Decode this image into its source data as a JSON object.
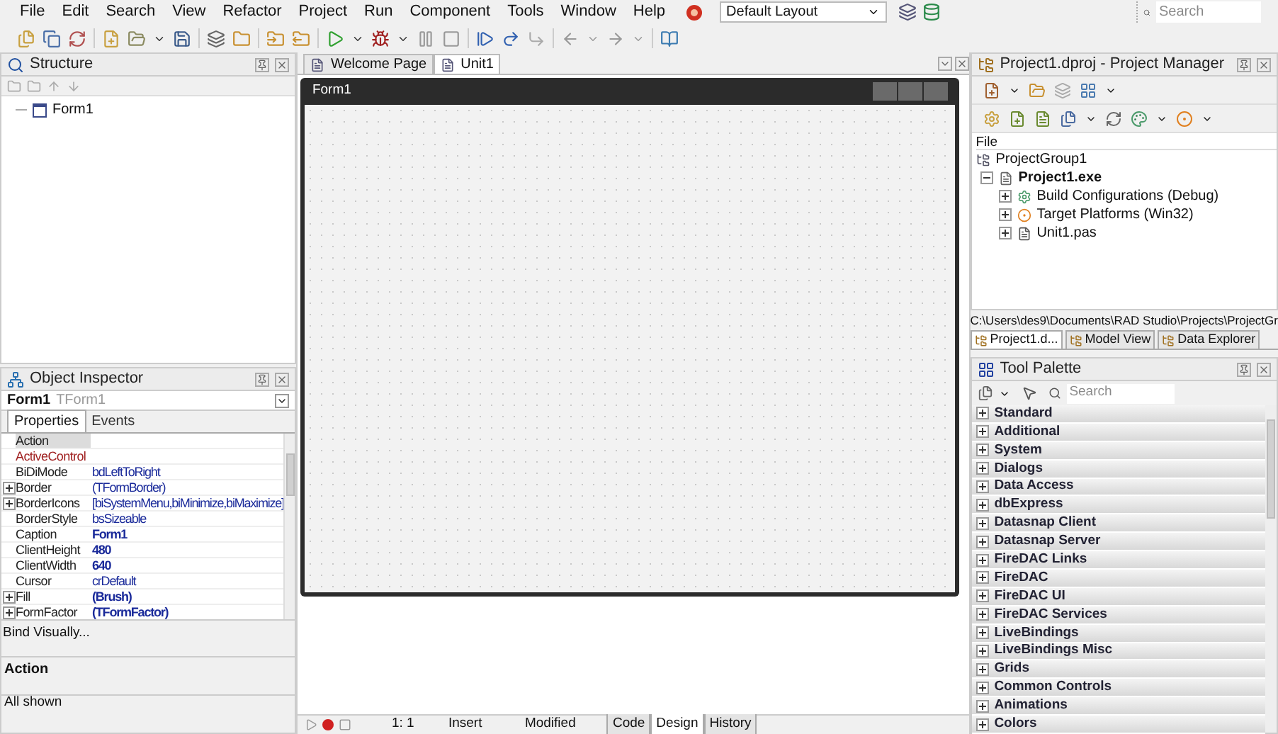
{
  "menu": [
    "File",
    "Edit",
    "Search",
    "View",
    "Refactor",
    "Project",
    "Run",
    "Component",
    "Tools",
    "Window",
    "Help"
  ],
  "layout_combo": {
    "value": "Default Layout"
  },
  "search": {
    "placeholder": "Search"
  },
  "structure": {
    "title": "Structure",
    "tree": [
      {
        "label": "Form1"
      }
    ]
  },
  "object_inspector": {
    "title": "Object Inspector",
    "selector": {
      "name": "Form1",
      "type": "TForm1"
    },
    "tabs": [
      {
        "label": "Properties",
        "selected": true
      },
      {
        "label": "Events",
        "selected": false
      }
    ],
    "properties": [
      {
        "name": "Action",
        "kind": "plain",
        "expandable": false,
        "selected": true
      },
      {
        "name": "ActiveControl",
        "kind": "reference",
        "expandable": false,
        "selected": false
      },
      {
        "name": "BiDiMode",
        "value": "bdLeftToRight",
        "kind": "plain",
        "expandable": false,
        "modified": false,
        "selected": false
      },
      {
        "name": "Border",
        "value": "(TFormBorder)",
        "kind": "plain",
        "expandable": true,
        "modified": false,
        "selected": false
      },
      {
        "name": "BorderIcons",
        "value": "[biSystemMenu,biMinimize,biMaximize]",
        "kind": "plain",
        "expandable": true,
        "modified": false,
        "selected": false
      },
      {
        "name": "BorderStyle",
        "value": "bsSizeable",
        "kind": "plain",
        "expandable": false,
        "modified": false,
        "selected": false
      },
      {
        "name": "Caption",
        "value": "Form1",
        "kind": "plain",
        "expandable": false,
        "modified": true,
        "selected": false
      },
      {
        "name": "ClientHeight",
        "value": "480",
        "kind": "plain",
        "expandable": false,
        "modified": true,
        "selected": false
      },
      {
        "name": "ClientWidth",
        "value": "640",
        "kind": "plain",
        "expandable": false,
        "modified": true,
        "selected": false
      },
      {
        "name": "Cursor",
        "value": "crDefault",
        "kind": "plain",
        "expandable": false,
        "modified": false,
        "selected": false
      },
      {
        "name": "Fill",
        "value": "(Brush)",
        "kind": "plain",
        "expandable": true,
        "modified": true,
        "selected": false
      },
      {
        "name": "FormFactor",
        "value": "(TFormFactor)",
        "kind": "plain",
        "expandable": true,
        "modified": true,
        "selected": false
      }
    ],
    "bind_link": "Bind Visually...",
    "description_title": "Action",
    "status": "All shown"
  },
  "editor": {
    "tabs": [
      {
        "label": "Welcome Page",
        "selected": false
      },
      {
        "label": "Unit1",
        "selected": true
      }
    ],
    "form_title": "Form1",
    "position": "1: 1",
    "mode": "Insert",
    "state": "Modified",
    "view_tabs": [
      {
        "label": "Code",
        "selected": false
      },
      {
        "label": "Design",
        "selected": true
      },
      {
        "label": "History",
        "selected": false
      }
    ]
  },
  "project_manager": {
    "title": "Project1.dproj - Project Manager",
    "column": "File",
    "tree": {
      "label": "ProjectGroup1",
      "children": [
        {
          "label": "Project1.exe",
          "expanded": true,
          "children": [
            {
              "label": "Build Configurations (Debug)",
              "expanded": false,
              "kind": "config"
            },
            {
              "label": "Target Platforms (Win32)",
              "expanded": false,
              "kind": "platform"
            },
            {
              "label": "Unit1.pas",
              "expanded": false,
              "kind": "file"
            }
          ]
        }
      ]
    },
    "path": "C:\\Users\\des9\\Documents\\RAD Studio\\Projects\\ProjectGr",
    "tabs": [
      {
        "label": "Project1.d...",
        "selected": true
      },
      {
        "label": "Model View",
        "selected": false
      },
      {
        "label": "Data Explorer",
        "selected": false
      }
    ]
  },
  "tool_palette": {
    "title": "Tool Palette",
    "search_placeholder": "Search",
    "categories": [
      {
        "label": "Standard",
        "expanded": false
      },
      {
        "label": "Additional",
        "expanded": false
      },
      {
        "label": "System",
        "expanded": false
      },
      {
        "label": "Dialogs",
        "expanded": false
      },
      {
        "label": "Data Access",
        "expanded": false
      },
      {
        "label": "dbExpress",
        "expanded": false
      },
      {
        "label": "Datasnap Client",
        "expanded": false
      },
      {
        "label": "Datasnap Server",
        "expanded": false
      },
      {
        "label": "FireDAC Links",
        "expanded": false
      },
      {
        "label": "FireDAC",
        "expanded": false
      },
      {
        "label": "FireDAC UI",
        "expanded": false
      },
      {
        "label": "FireDAC Services",
        "expanded": false
      },
      {
        "label": "LiveBindings",
        "expanded": false
      },
      {
        "label": "LiveBindings Misc",
        "expanded": false
      },
      {
        "label": "Grids",
        "expanded": false
      },
      {
        "label": "Common Controls",
        "expanded": false
      },
      {
        "label": "Animations",
        "expanded": false
      },
      {
        "label": "Colors",
        "expanded": false
      }
    ]
  }
}
